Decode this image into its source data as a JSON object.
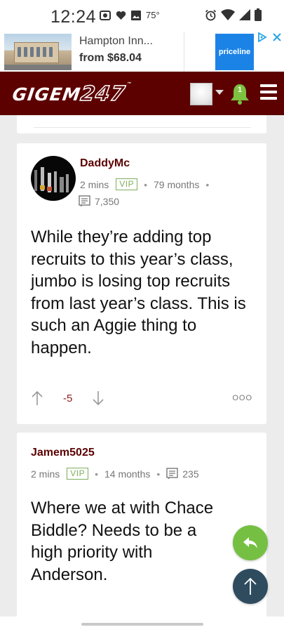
{
  "status_bar": {
    "time": "12:24",
    "temperature": "75°",
    "icons": [
      "sim-icon",
      "heart-icon",
      "image-icon",
      "alarm-icon",
      "wifi-icon",
      "signal-icon",
      "battery-icon"
    ]
  },
  "ad": {
    "title": "Hampton Inn...",
    "price": "from $68.04",
    "brand": "priceline",
    "icons": [
      "adchoices-icon",
      "close-icon"
    ]
  },
  "header": {
    "logo_text": "GIGEM",
    "logo_number": "247",
    "logo_tm": "™",
    "notification_count": "1",
    "colors": {
      "maroon": "#5c0000",
      "bell_green": "#7cc13f"
    }
  },
  "posts": [
    {
      "username": "DaddyMc",
      "time": "2 mins",
      "badge": "VIP",
      "tenure": "79 months",
      "post_count": "7,350",
      "body": "While they’re adding top recruits to this year’s class, jumbo is losing top recruits from last year’s class. This is such an Aggie thing to happen.",
      "score": "-5",
      "more": "OOO"
    },
    {
      "username": "Jamem5025",
      "time": "2 mins",
      "badge": "VIP",
      "tenure": "14 months",
      "post_count": "235",
      "body": "Where we at with Chace Biddle? Needs to be a high priority with Anderson."
    }
  ],
  "fabs": {
    "reply_color": "#75c043",
    "top_color": "#2f4c5f"
  }
}
